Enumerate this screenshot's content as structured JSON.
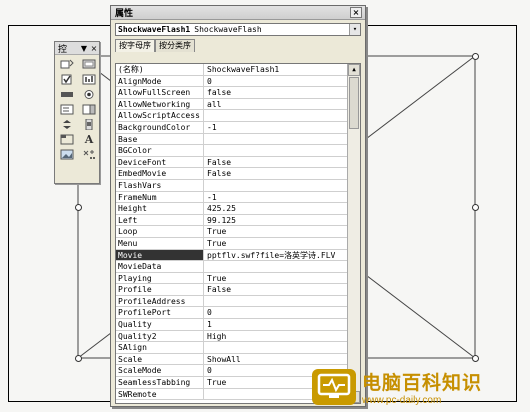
{
  "properties_window": {
    "title": "属性",
    "close_label": "×",
    "object_name": "ShockwaveFlash1",
    "object_type": "ShockwaveFlash",
    "dropdown_arrow": "▾",
    "tabs": [
      {
        "label": "按字母序",
        "active": true
      },
      {
        "label": "按分类序",
        "active": false
      }
    ],
    "rows": [
      {
        "key": "(名称)",
        "value": "ShockwaveFlash1"
      },
      {
        "key": "AlignMode",
        "value": "0"
      },
      {
        "key": "AllowFullScreen",
        "value": "false"
      },
      {
        "key": "AllowNetworking",
        "value": "all"
      },
      {
        "key": "AllowScriptAccess",
        "value": ""
      },
      {
        "key": "BackgroundColor",
        "value": "-1"
      },
      {
        "key": "Base",
        "value": ""
      },
      {
        "key": "BGColor",
        "value": ""
      },
      {
        "key": "DeviceFont",
        "value": "False"
      },
      {
        "key": "EmbedMovie",
        "value": "False"
      },
      {
        "key": "FlashVars",
        "value": ""
      },
      {
        "key": "FrameNum",
        "value": "-1"
      },
      {
        "key": "Height",
        "value": "425.25"
      },
      {
        "key": "Left",
        "value": "99.125"
      },
      {
        "key": "Loop",
        "value": "True"
      },
      {
        "key": "Menu",
        "value": "True"
      },
      {
        "key": "Movie",
        "value": "pptflv.swf?file=洛英学诗.FLV",
        "selected": true
      },
      {
        "key": "MovieData",
        "value": ""
      },
      {
        "key": "Playing",
        "value": "True"
      },
      {
        "key": "Profile",
        "value": "False"
      },
      {
        "key": "ProfileAddress",
        "value": ""
      },
      {
        "key": "ProfilePort",
        "value": "0"
      },
      {
        "key": "Quality",
        "value": "1"
      },
      {
        "key": "Quality2",
        "value": "High"
      },
      {
        "key": "SAlign",
        "value": ""
      },
      {
        "key": "Scale",
        "value": "ShowAll"
      },
      {
        "key": "ScaleMode",
        "value": "0"
      },
      {
        "key": "SeamlessTabbing",
        "value": "True"
      },
      {
        "key": "SWRemote",
        "value": ""
      }
    ]
  },
  "toolbox": {
    "title": "控",
    "menu_glyph": "▼",
    "close_glyph": "×",
    "tools": [
      "check-box-icon",
      "command-button-icon",
      "checkbox-icon",
      "list-box-icon",
      "text-box-icon",
      "option-button-icon",
      "combo-box-icon",
      "toggle-button-icon",
      "spin-button-icon",
      "scroll-bar-icon",
      "frame-icon",
      "label-icon",
      "image-icon",
      "more-controls-icon"
    ],
    "label_tool_glyph": "A"
  },
  "watermark": {
    "name": "电脑百科知识",
    "url": "www.pc-daily.com",
    "color": "#c68f00"
  }
}
